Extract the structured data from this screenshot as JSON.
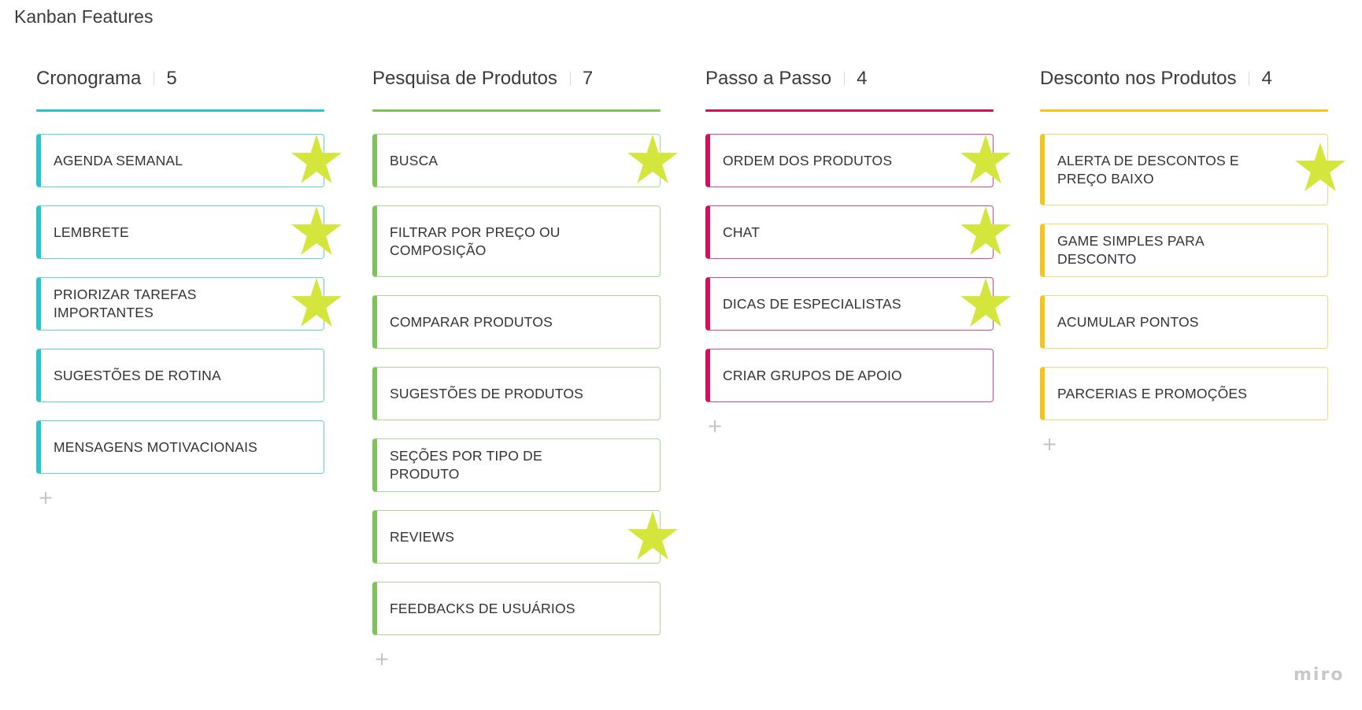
{
  "board": {
    "title": "Kanban Features",
    "logo": "miro",
    "star_color": "#d4e63b"
  },
  "columns": [
    {
      "title": "Cronograma",
      "count": "5",
      "color": "#2bc4cc",
      "border_color": "#5fd3d8",
      "cards": [
        {
          "label": "AGENDA SEMANAL",
          "starred": true,
          "lines": 1
        },
        {
          "label": "LEMBRETE",
          "starred": true,
          "lines": 1
        },
        {
          "label": "PRIORIZAR TAREFAS IMPORTANTES",
          "starred": true,
          "lines": 1
        },
        {
          "label": "SUGESTÕES DE ROTINA",
          "starred": false,
          "lines": 1
        },
        {
          "label": "MENSAGENS MOTIVACIONAIS",
          "starred": false,
          "lines": 1
        }
      ],
      "add_label": "+"
    },
    {
      "title": "Pesquisa de Produtos",
      "count": "7",
      "color": "#7cc45a",
      "border_color": "#a9d992",
      "cards": [
        {
          "label": "BUSCA",
          "starred": true,
          "lines": 1
        },
        {
          "label": "FILTRAR POR PREÇO OU COMPOSIÇÃO",
          "starred": false,
          "lines": 2
        },
        {
          "label": "COMPARAR PRODUTOS",
          "starred": false,
          "lines": 1
        },
        {
          "label": "SUGESTÕES DE PRODUTOS",
          "starred": false,
          "lines": 1
        },
        {
          "label": "SEÇÕES POR TIPO DE PRODUTO",
          "starred": false,
          "lines": 1
        },
        {
          "label": "REVIEWS",
          "starred": true,
          "lines": 1
        },
        {
          "label": "FEEDBACKS DE USUÁRIOS",
          "starred": false,
          "lines": 1
        }
      ],
      "add_label": "+"
    },
    {
      "title": "Passo a Passo",
      "count": "4",
      "color": "#d1105f",
      "border_color": "#d4498a",
      "cards": [
        {
          "label": "ORDEM DOS PRODUTOS",
          "starred": true,
          "lines": 1
        },
        {
          "label": "CHAT",
          "starred": true,
          "lines": 1
        },
        {
          "label": "DICAS DE ESPECIALISTAS",
          "starred": true,
          "lines": 1
        },
        {
          "label": "CRIAR GRUPOS DE APOIO",
          "starred": false,
          "lines": 1
        }
      ],
      "add_label": "+"
    },
    {
      "title": "Desconto nos Produtos",
      "count": "4",
      "color": "#f5c518",
      "border_color": "#f2d97a",
      "cards": [
        {
          "label": "ALERTA DE DESCONTOS E PREÇO BAIXO",
          "starred": true,
          "lines": 2
        },
        {
          "label": "GAME SIMPLES PARA DESCONTO",
          "starred": false,
          "lines": 1
        },
        {
          "label": "ACUMULAR PONTOS",
          "starred": false,
          "lines": 1
        },
        {
          "label": "PARCERIAS E PROMOÇÕES",
          "starred": false,
          "lines": 1
        }
      ],
      "add_label": "+"
    }
  ]
}
